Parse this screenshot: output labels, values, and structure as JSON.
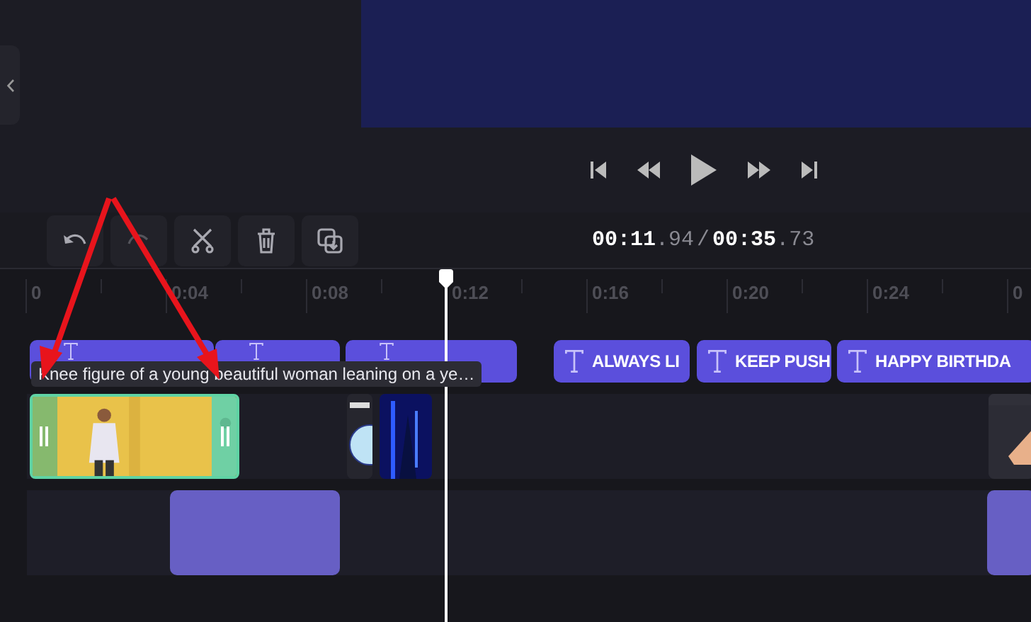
{
  "toolbar": {
    "buttons": [
      {
        "kind": "undo",
        "disabled": false
      },
      {
        "kind": "redo",
        "disabled": true
      },
      {
        "kind": "split",
        "disabled": false
      },
      {
        "kind": "delete",
        "disabled": false
      },
      {
        "kind": "duplicate",
        "disabled": false
      }
    ]
  },
  "time": {
    "current": "00:11",
    "current_fraction": ".94",
    "separator": "/",
    "total": "00:35",
    "total_fraction": ".73"
  },
  "ruler": {
    "ticks": [
      "0",
      "0:04",
      "0:08",
      "0:12",
      "0:16",
      "0:20",
      "0:24",
      "0"
    ]
  },
  "text_track": {
    "clips": [
      {
        "kind": "covered"
      },
      {
        "kind": "covered"
      },
      {
        "kind": "covered"
      },
      {
        "kind": "labeled",
        "label": "ALWAYS LI"
      },
      {
        "kind": "labeled",
        "label": "KEEP PUSH"
      },
      {
        "kind": "labeled",
        "label": "HAPPY BIRTHDA"
      }
    ]
  },
  "tooltip": "Knee figure of a young beautiful woman leaning on a ye…",
  "video_track": {
    "clips": [
      {
        "kind": "woman",
        "selected": true
      },
      {
        "kind": "sticker",
        "selected": false
      },
      {
        "kind": "night",
        "selected": false
      },
      {
        "kind": "hand",
        "selected": false
      }
    ]
  },
  "audio_track": {
    "clips": [
      {
        "kind": "block"
      },
      {
        "kind": "block"
      }
    ]
  }
}
